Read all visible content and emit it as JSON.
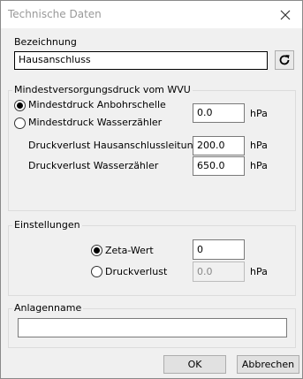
{
  "window": {
    "title": "Technische Daten"
  },
  "bezeichnung": {
    "label": "Bezeichnung",
    "value": "Hausanschluss"
  },
  "mindest": {
    "title": "Mindestversorgungsdruck vom WVU",
    "radio_anbohr": "Mindestdruck Anbohrschelle",
    "radio_wasser": "Mindestdruck Wasserzähler",
    "druck_value": "0.0",
    "druck_unit": "hPa",
    "verlust_haus_label": "Druckverlust Hausanschlussleitung",
    "verlust_haus_value": "200.0",
    "verlust_haus_unit": "hPa",
    "verlust_wasser_label": "Druckverlust Wasserzähler",
    "verlust_wasser_value": "650.0",
    "verlust_wasser_unit": "hPa"
  },
  "einstellungen": {
    "title": "Einstellungen",
    "radio_zeta": "Zeta-Wert",
    "zeta_value": "0",
    "radio_druckverlust": "Druckverlust",
    "druckverlust_value": "0.0",
    "druckverlust_unit": "hPa"
  },
  "anlage": {
    "title": "Anlagenname",
    "value": ""
  },
  "buttons": {
    "ok": "OK",
    "cancel": "Abbrechen"
  },
  "icons": {
    "close": "close-icon",
    "refresh": "refresh-icon"
  }
}
